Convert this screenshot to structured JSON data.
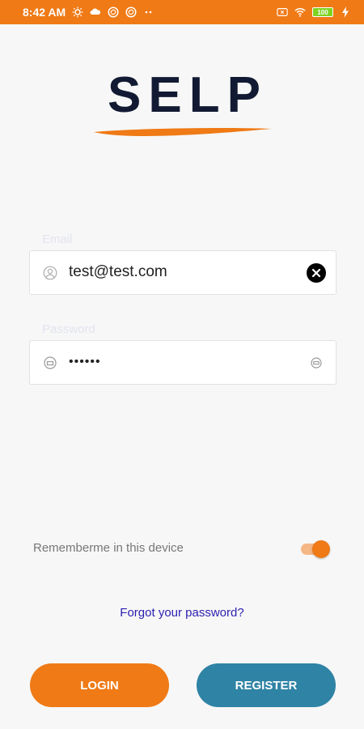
{
  "status_bar": {
    "time": "8:42 AM",
    "left_icons": [
      "sun-icon",
      "cloud-icon",
      "sync-icon",
      "sync-icon",
      "more-dots-icon"
    ],
    "right_icons": [
      "sim-icon",
      "wifi-icon",
      "battery-icon",
      "charging-icon"
    ],
    "battery_level": "100"
  },
  "logo": {
    "text": "SELP"
  },
  "email": {
    "label": "Email",
    "value": "test@test.com",
    "icon": "user-icon",
    "clear_icon": "clear-icon"
  },
  "password": {
    "label": "Password",
    "value": "123456",
    "icon": "lock-icon",
    "toggle_icon": "eye-icon"
  },
  "remember": {
    "label": "Rememberme in this device",
    "enabled": true
  },
  "forgot": {
    "label": "Forgot your password?"
  },
  "buttons": {
    "login": "LOGIN",
    "register": "REGISTER"
  },
  "colors": {
    "accent": "#ef7a16",
    "register": "#2f83a5",
    "link": "#2a1fb0",
    "logo": "#121a33"
  }
}
